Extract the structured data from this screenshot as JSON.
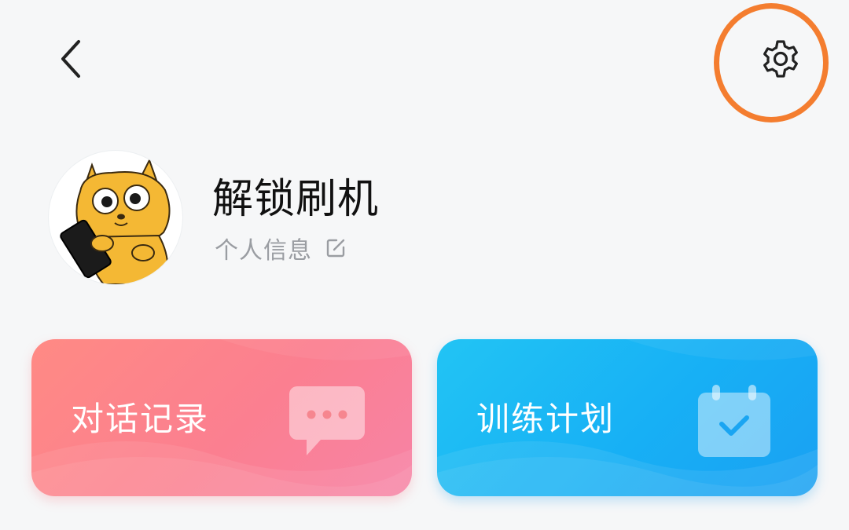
{
  "header": {
    "back_icon": "chevron-left-icon",
    "settings_icon": "gear-icon"
  },
  "profile": {
    "name": "解锁刷机",
    "info_label": "个人信息",
    "edit_icon": "edit-icon",
    "avatar_icon": "cartoon-dog-avatar"
  },
  "cards": {
    "chat": {
      "label": "对话记录",
      "icon": "chat-bubble-icon",
      "color": "#fb7f90"
    },
    "plan": {
      "label": "训练计划",
      "icon": "calendar-check-icon",
      "color": "#17b0f5"
    }
  },
  "colors": {
    "background": "#f6f7f8",
    "highlight": "#f47d2f"
  }
}
